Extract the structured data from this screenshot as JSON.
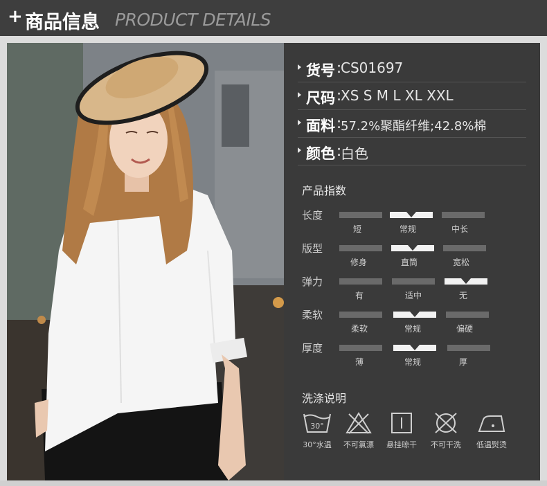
{
  "header": {
    "plus": "+",
    "title": "商品信息",
    "subtitle": "PRODUCT DETAILS"
  },
  "attributes": [
    {
      "key": "货号",
      "sep": ":",
      "value": " CS01697"
    },
    {
      "key": "尺码",
      "sep": ":",
      "value": " XS S M L XL  XXL"
    },
    {
      "key": "面料",
      "sep": ":",
      "value": "57.2%聚酯纤维;42.8%棉"
    },
    {
      "key": "颜色",
      "sep": ":",
      "value": " 白色"
    }
  ],
  "index_section": {
    "title": "产品指数",
    "rows": [
      {
        "label": "长度",
        "options": [
          "短",
          "常规",
          "中长"
        ],
        "selected_index": 1
      },
      {
        "label": "版型",
        "options": [
          "修身",
          "直筒",
          "宽松"
        ],
        "selected_index": 1
      },
      {
        "label": "弹力",
        "options": [
          "有",
          "适中",
          "无"
        ],
        "selected_index": 2
      },
      {
        "label": "柔软",
        "options": [
          "柔软",
          "常规",
          "偏硬"
        ],
        "selected_index": 1
      },
      {
        "label": "厚度",
        "options": [
          "薄",
          "常规",
          "厚"
        ],
        "selected_index": 1
      }
    ]
  },
  "wash_section": {
    "title": "洗涤说明",
    "items": [
      {
        "icon": "wash-30-icon",
        "label": "30°水温",
        "number": "30°"
      },
      {
        "icon": "no-bleach-icon",
        "label": "不可氯漂"
      },
      {
        "icon": "hang-dry-icon",
        "label": "悬挂晾干"
      },
      {
        "icon": "no-dry-clean-icon",
        "label": "不可干洗"
      },
      {
        "icon": "low-iron-icon",
        "label": "低温熨烫"
      }
    ]
  },
  "colors": {
    "header_bg": "#3e3e3e",
    "panel_bg": "#3a3a3a",
    "scale_inactive": "#6a6a6a",
    "scale_active": "#f2f2f2",
    "shirt": "#f5f5f5",
    "pants": "#141414"
  }
}
